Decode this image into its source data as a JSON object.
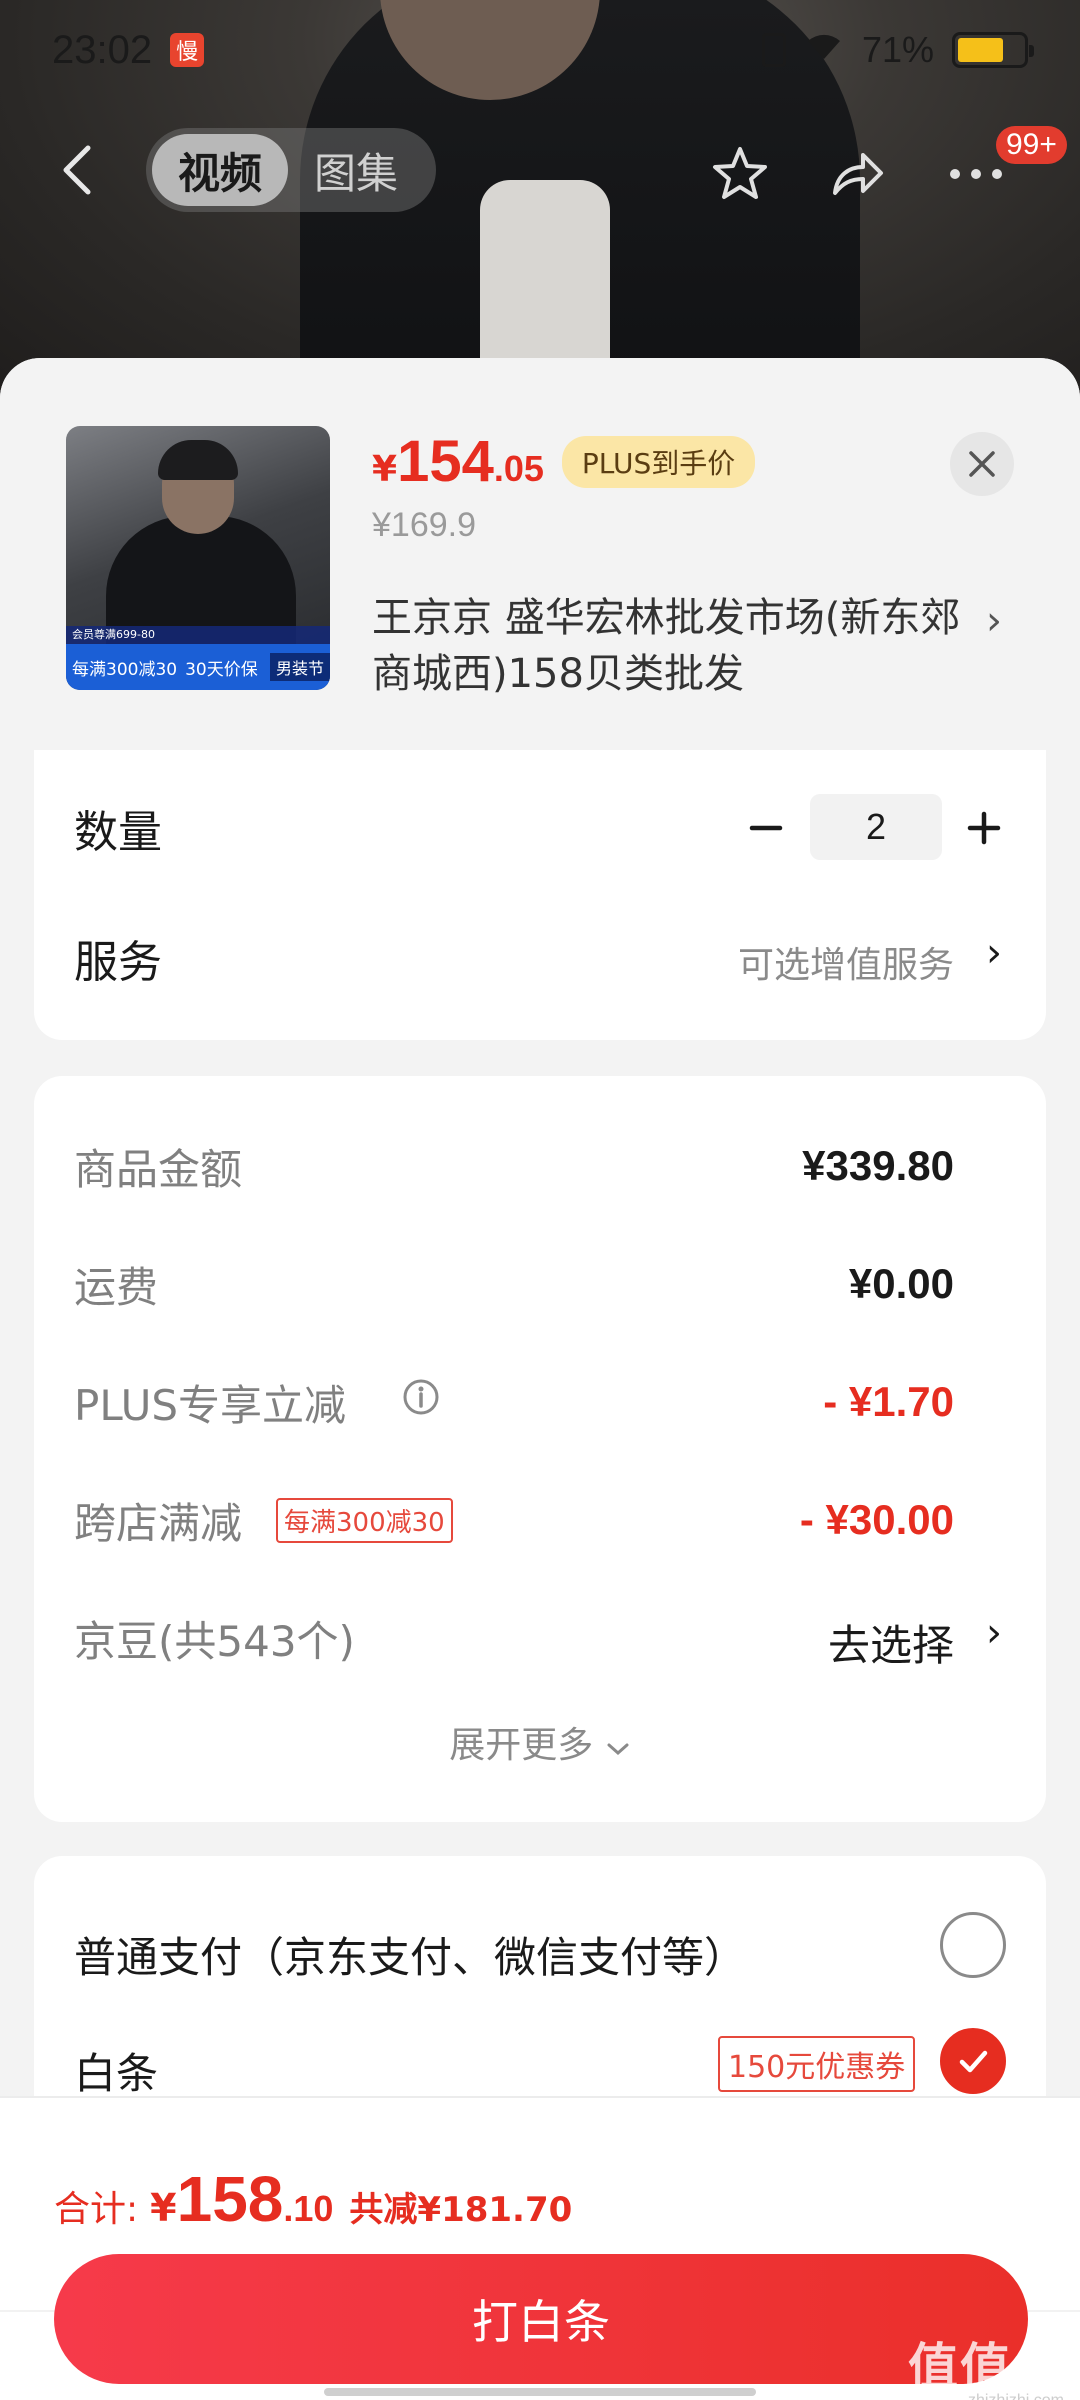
{
  "status_bar": {
    "time": "23:02",
    "app_icon_text": "慢",
    "battery_text": "71%",
    "battery_level": 0.71
  },
  "nav": {
    "tabs": [
      {
        "label": "视频",
        "active": true
      },
      {
        "label": "图集",
        "active": false
      }
    ],
    "icons": [
      "back-arrow-icon",
      "star-icon",
      "share-icon",
      "more-icon"
    ],
    "message_badge": "99+"
  },
  "product": {
    "price_symbol": "¥",
    "price_integer": "154",
    "price_decimal": ".05",
    "plus_tag": "PLUS到手价",
    "original_price": "¥169.9",
    "shop_name": "王京京 盛华宏林批发市场(新东郊商城西)158贝类批发",
    "thumb_banner_main": "每满300减30",
    "thumb_banner_second": "30天价保",
    "thumb_banner_tag": "男装节",
    "thumb_top_text": "会员尊满699-80"
  },
  "quantity": {
    "label": "数量",
    "value": "2"
  },
  "service": {
    "label": "服务",
    "text": "可选增值服务"
  },
  "amounts": {
    "items": [
      {
        "label": "商品金额",
        "value": "¥339.80"
      },
      {
        "label": "运费",
        "value": "¥0.00"
      },
      {
        "label": "PLUS专享立减",
        "value": "- ¥1.70"
      },
      {
        "label": "跨店满减",
        "tag": "每满300减30",
        "value": "- ¥30.00"
      },
      {
        "label": "京豆(共543个)",
        "value": "去选择"
      }
    ],
    "expand_text": "展开更多"
  },
  "payment": {
    "options": [
      {
        "label": "普通支付（京东支付、微信支付等）",
        "selected": false
      },
      {
        "label": "白条",
        "coupon": "150元优惠券",
        "selected": true
      }
    ]
  },
  "footer": {
    "total_label": "合计:",
    "total_symbol": "¥",
    "total_integer": "158",
    "total_decimal": ".10",
    "total_saving": "共减¥181.70",
    "pay_button": "打白条"
  },
  "watermark": {
    "main": "值值值",
    "sub": "zhizhizhi.com"
  },
  "colors": {
    "accent_red": "#e62d20",
    "plus_gold": "#fbe6a6",
    "battery_yellow": "#f5c019"
  }
}
